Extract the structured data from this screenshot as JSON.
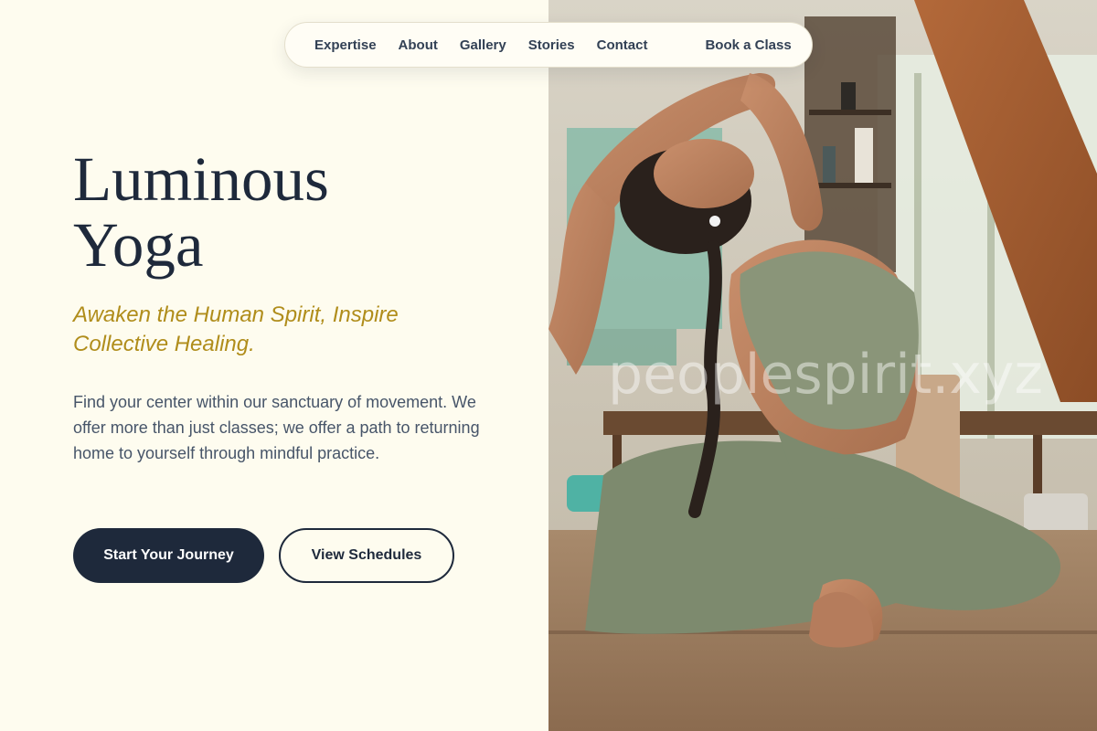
{
  "nav": {
    "links": [
      "Expertise",
      "About",
      "Gallery",
      "Stories",
      "Contact"
    ],
    "cta_label": "Book a Class"
  },
  "hero": {
    "title_line1": "Luminous",
    "title_line2": "Yoga",
    "tagline": "Awaken the Human Spirit, Inspire Collective Healing.",
    "body": "Find your center within our sanctuary of movement. We offer more than just classes; we offer a path to returning home to yourself through mindful practice.",
    "primary_button": "Start Your Journey",
    "secondary_button": "View Schedules"
  },
  "photo": {
    "watermark": "peoplespirit.xyz"
  },
  "colors": {
    "background": "#fefcef",
    "navy": "#1e293b",
    "gold_accent": "#b08d1b",
    "body_text": "#475569",
    "sage_outfit": "#7c8a6f"
  }
}
